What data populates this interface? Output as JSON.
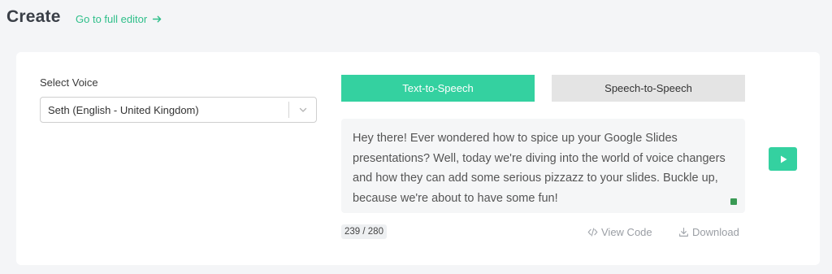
{
  "header": {
    "title": "Create",
    "full_editor_link": "Go to full editor"
  },
  "voice": {
    "label": "Select Voice",
    "selected": "Seth (English - United Kingdom)"
  },
  "tabs": [
    {
      "label": "Text-to-Speech",
      "active": true
    },
    {
      "label": "Speech-to-Speech",
      "active": false
    }
  ],
  "editor": {
    "text": "Hey there! Ever wondered how to spice up your Google Slides presentations? Well, today we're diving into the world of voice changers and how they can add some serious pizzazz to your slides. Buckle up, because we're about to have some fun!",
    "char_count": "239 / 280"
  },
  "actions": {
    "view_code": "View Code",
    "download": "Download"
  },
  "colors": {
    "accent": "#34d1a0",
    "link": "#2fbf8a",
    "inactive_tab": "#e4e4e4"
  }
}
